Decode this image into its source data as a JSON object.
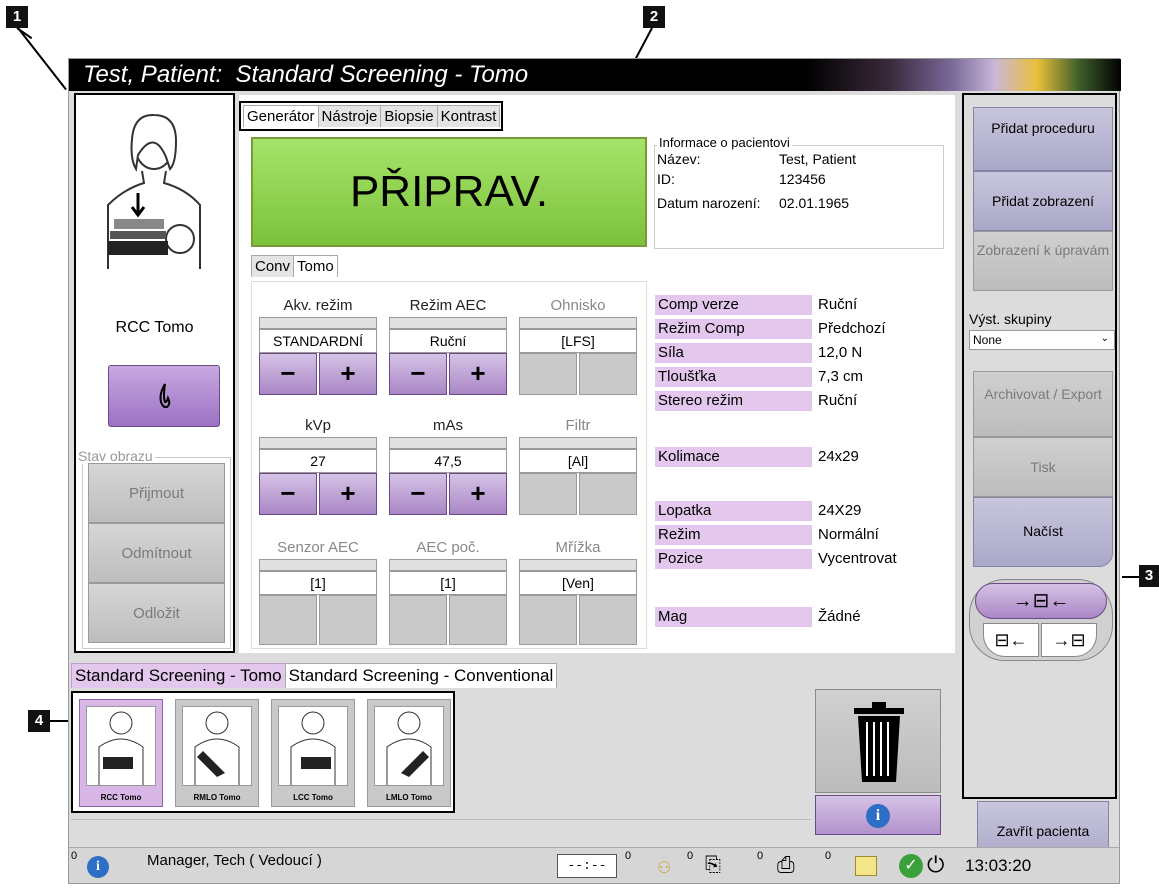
{
  "callouts": [
    "1",
    "2",
    "3",
    "4"
  ],
  "title": "Test, Patient:  Standard Screening - Tomo",
  "left": {
    "view_label": "RCC Tomo",
    "status_legend": "Stav obrazu",
    "accept": "Přijmout",
    "reject": "Odmítnout",
    "pend": "Odložit"
  },
  "tabs": [
    "Generátor",
    "Nástroje",
    "Biopsie",
    "Kontrast"
  ],
  "ready": "PŘIPRAV.",
  "patient": {
    "legend": "Informace o pacientovi",
    "name_label": "Název:",
    "name": "Test, Patient",
    "id_label": "ID:",
    "id": "123456",
    "dob_label": "Datum narození:",
    "dob": "02.01.1965"
  },
  "subtabs": [
    "Conv",
    "Tomo"
  ],
  "controls": {
    "acq_mode": {
      "label": "Akv. režim",
      "value": "STANDARDNÍ"
    },
    "aec_mode": {
      "label": "Režim AEC",
      "value": "Ruční"
    },
    "focus": {
      "label": "Ohnisko",
      "value": "[LFS]"
    },
    "kvp": {
      "label": "kVp",
      "value": "27"
    },
    "mas": {
      "label": "mAs",
      "value": "47,5"
    },
    "filter": {
      "label": "Filtr",
      "value": "[Al]"
    },
    "aec_sensor": {
      "label": "Senzor AEC",
      "value": "[1]"
    },
    "aec_count": {
      "label": "AEC poč.",
      "value": "[1]"
    },
    "grid": {
      "label": "Mřížka",
      "value": "[Ven]"
    },
    "minus": "−",
    "plus": "+"
  },
  "info": [
    {
      "label": "Comp verze",
      "value": "Ruční"
    },
    {
      "label": "Režim Comp",
      "value": "Předchozí"
    },
    {
      "label": "Síla",
      "value": "12,0 N"
    },
    {
      "label": "Tloušťka",
      "value": "7,3 cm"
    },
    {
      "label": "Stereo režim",
      "value": "Ruční"
    },
    {
      "label": "Kolimace",
      "value": "24x29"
    },
    {
      "label": "Lopatka",
      "value": "24X29"
    },
    {
      "label": "Režim",
      "value": "Normální"
    },
    {
      "label": "Pozice",
      "value": "Vycentrovat"
    },
    {
      "label": "Mag",
      "value": "Žádné"
    }
  ],
  "right": {
    "add_procedure": "Přidat proceduru",
    "add_view": "Přidat zobrazení",
    "edit_view": "Zobrazení k úpravám",
    "output_groups": "Výst. skupiny",
    "output_value": "None",
    "archive": "Archivovat / Export",
    "print": "Tisk",
    "retrieve": "Načíst",
    "close_patient": "Zavřít pacienta"
  },
  "proc_tabs": [
    "Standard Screening - Tomo",
    "Standard Screening - Conventional"
  ],
  "thumbnails": [
    "RCC Tomo",
    "RMLO Tomo",
    "LCC Tomo",
    "LMLO Tomo"
  ],
  "statusbar": {
    "user": "Manager, Tech ( Vedoucí )",
    "timer": "--:--",
    "counts": [
      "0",
      "0",
      "0",
      "0",
      "0",
      "0"
    ],
    "time": "13:03:20"
  },
  "colors": {
    "ready_green": "#8bd24a",
    "purple": "#b08ad0",
    "label_pink": "#e3c7ec"
  }
}
